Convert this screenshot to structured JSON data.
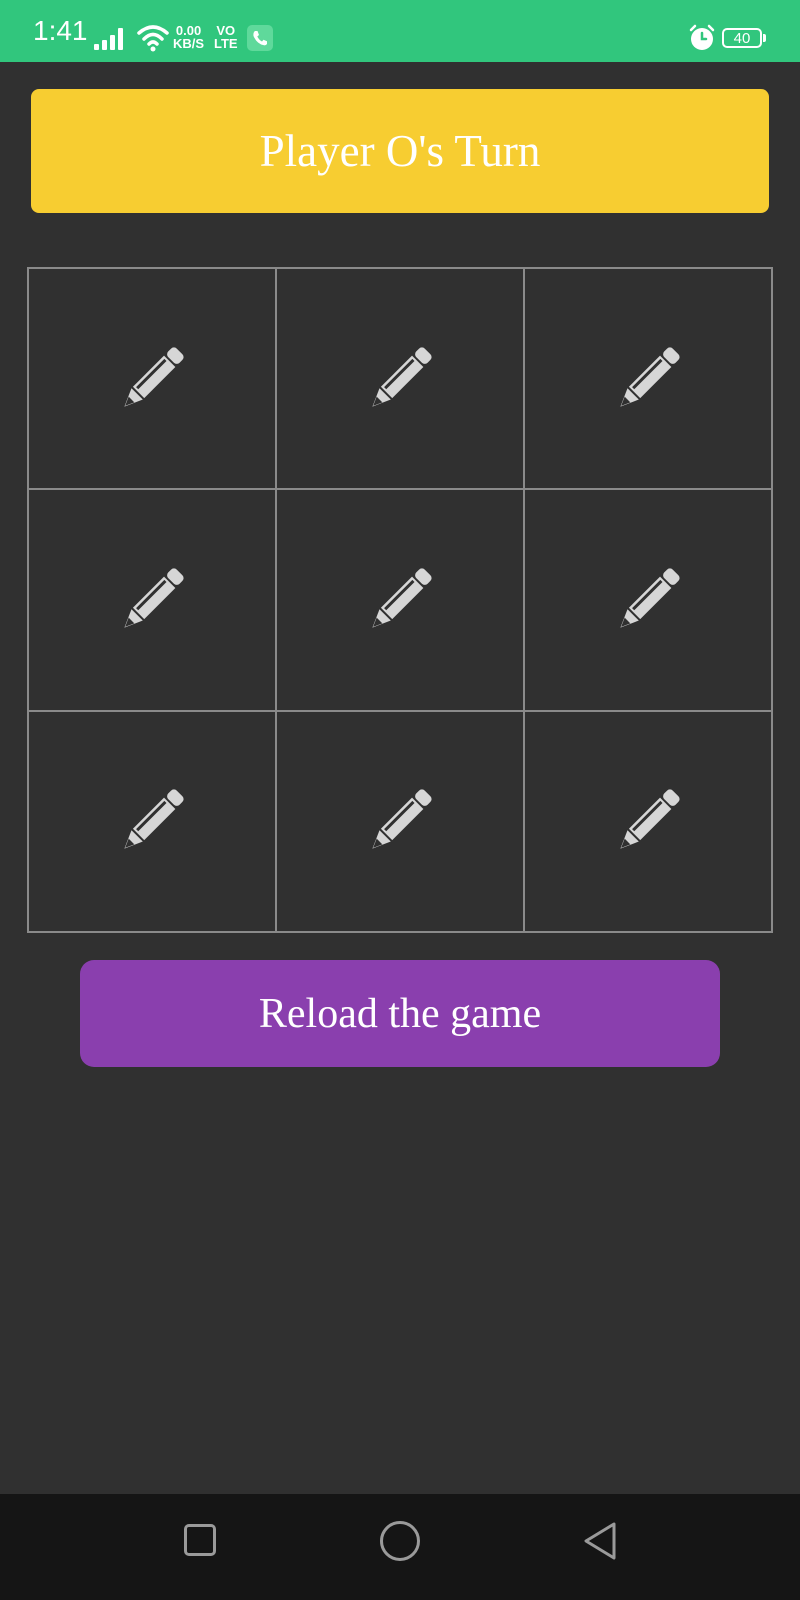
{
  "status_bar": {
    "time": "1:41",
    "net_speed_value": "0.00",
    "net_speed_unit": "KB/S",
    "volte_top": "VO",
    "volte_bottom": "LTE",
    "battery": "40",
    "icons": [
      "signal-icon",
      "wifi-icon",
      "call-icon",
      "alarm-icon",
      "battery-icon"
    ]
  },
  "game": {
    "turn_text": "Player O's Turn",
    "cell_icon": "pencil-icon",
    "cells": [
      "",
      "",
      "",
      "",
      "",
      "",
      "",
      "",
      ""
    ],
    "reload_label": "Reload the game"
  },
  "colors": {
    "status_bar": "#31c67d",
    "background": "#303030",
    "turn_banner": "#f7cd31",
    "reload_button": "#8a3fae",
    "pencil": "#d6d6d6",
    "grid_line": "#8a8a8a",
    "nav_bar": "#151515"
  },
  "nav_bar": {
    "icons": [
      "recents-square-icon",
      "home-circle-icon",
      "back-triangle-icon"
    ]
  }
}
